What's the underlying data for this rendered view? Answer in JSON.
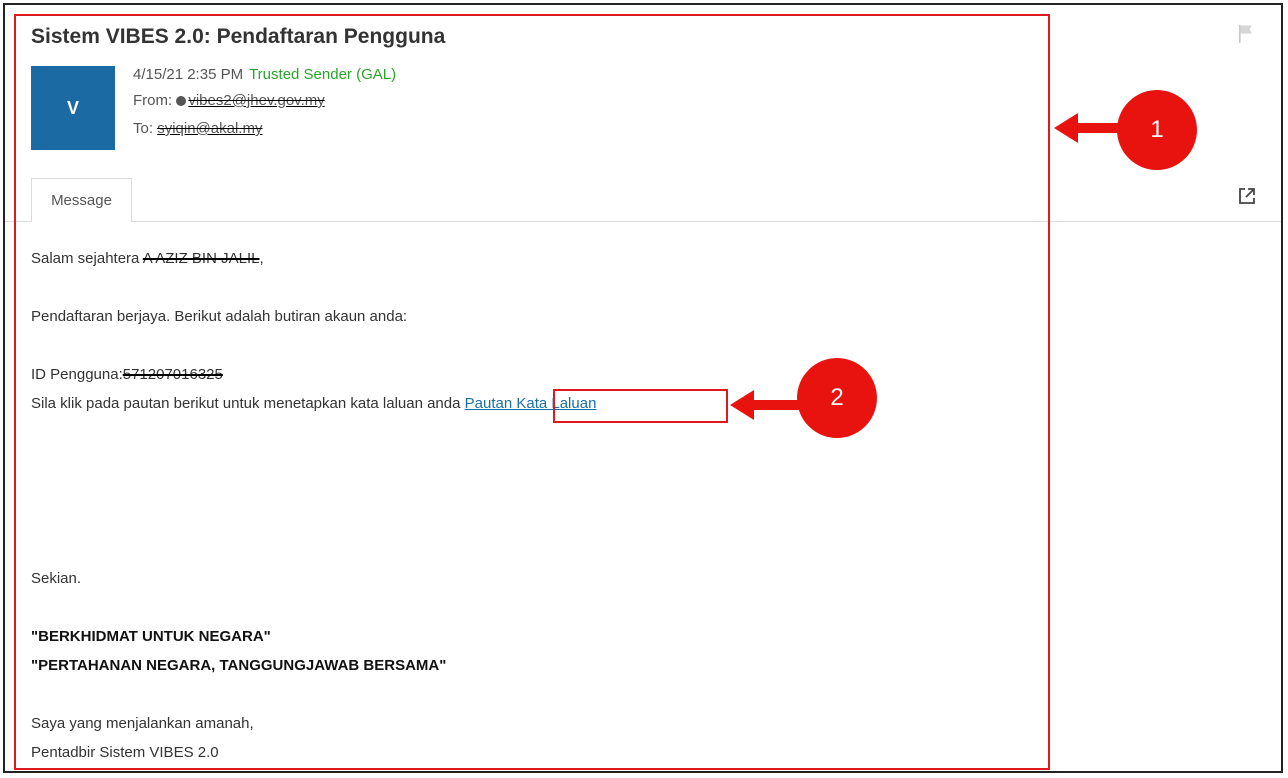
{
  "email": {
    "subject": "Sistem VIBES 2.0: Pendaftaran Pengguna",
    "avatar_letter": "V",
    "date": "4/15/21 2:35 PM",
    "trusted_label": "Trusted Sender (GAL)",
    "from_label": "From:",
    "from_value": "vibes2@jhev.gov.my",
    "to_label": "To:",
    "to_value": "syiqin@akal.my",
    "tab_label": "Message"
  },
  "body": {
    "greeting_prefix": "Salam sejahtera",
    "greeting_name": "A AZIZ BIN JALIL",
    "greeting_suffix": ",",
    "line_success": "Pendaftaran berjaya. Berikut adalah butiran akaun anda:",
    "id_label": "ID Pengguna:",
    "id_value": "571207016325",
    "instruction": "Sila klik pada pautan berikut untuk menetapkan kata laluan anda",
    "link_text": "Pautan Kata Laluan",
    "closing": "Sekian.",
    "slogan1": "\"BERKHIDMAT UNTUK NEGARA\"",
    "slogan2": "\"PERTAHANAN NEGARA, TANGGUNGJAWAB BERSAMA\"",
    "sign1": "Saya yang menjalankan amanah,",
    "sign2": "Pentadbir Sistem VIBES 2.0"
  },
  "annotations": {
    "callout1": "1",
    "callout2": "2",
    "color": "#e8120f"
  },
  "colors": {
    "avatar": "#1b6aa3",
    "trusted": "#2aa52a",
    "link": "#1b6fa6"
  },
  "icons": [
    "flag-icon",
    "popout-icon"
  ]
}
